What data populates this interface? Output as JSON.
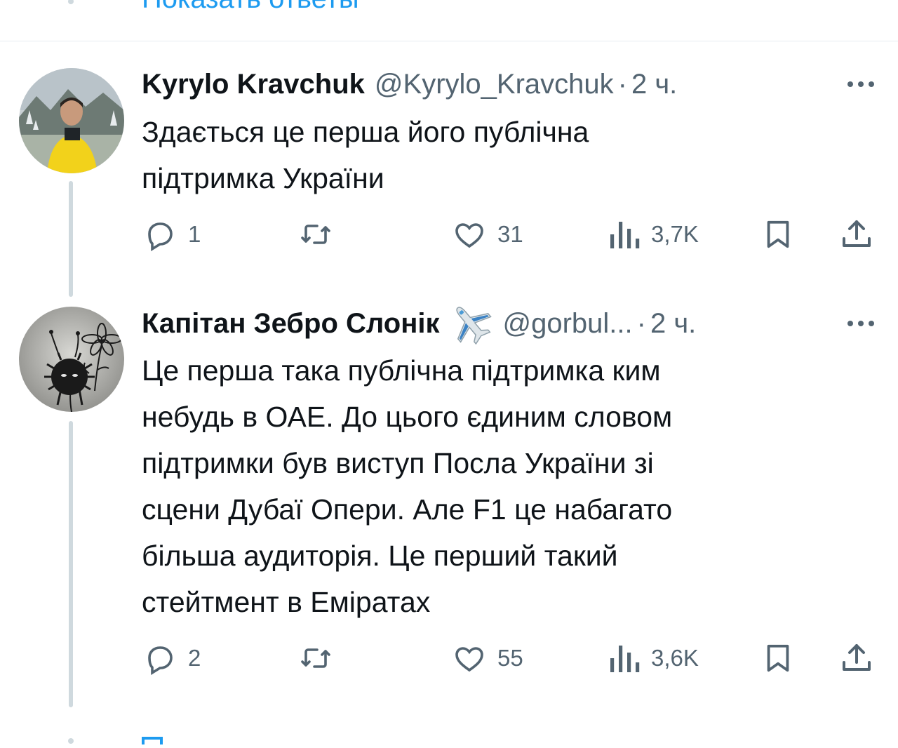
{
  "top": {
    "show_replies": "Показать ответы"
  },
  "tweets": [
    {
      "name": "Kyrylo Kravchuk",
      "handle": "@Kyrylo_Kravchuk",
      "dot": "·",
      "time": "2 ч.",
      "text": "Здається це перша його публічна\nпідтримка України",
      "counts": {
        "replies": "1",
        "likes": "31",
        "views": "3,7K"
      }
    },
    {
      "name": "Капітан Зебро Слонік",
      "handle": "@gorbul...",
      "dot": "·",
      "time": "2 ч.",
      "text": "Це перша така публічна підтримка ким\nнебудь в ОАЕ. До цього єдиним словом\nпідтримки був виступ Посла України зі\nсцени Дубаї Опери. Але F1 це набагато\nбільша аудиторія. Це перший такий\nстейтмент в Еміратах",
      "counts": {
        "replies": "2",
        "likes": "55",
        "views": "3,6K"
      }
    }
  ],
  "icons": [
    "reply-icon",
    "retweet-icon",
    "like-icon",
    "views-icon",
    "bookmark-icon",
    "share-icon",
    "more-icon",
    "airplane-emoji-icon"
  ],
  "colors": {
    "link": "#1d9bf0",
    "secondary": "#536471",
    "thread_line": "#cfd9de"
  }
}
